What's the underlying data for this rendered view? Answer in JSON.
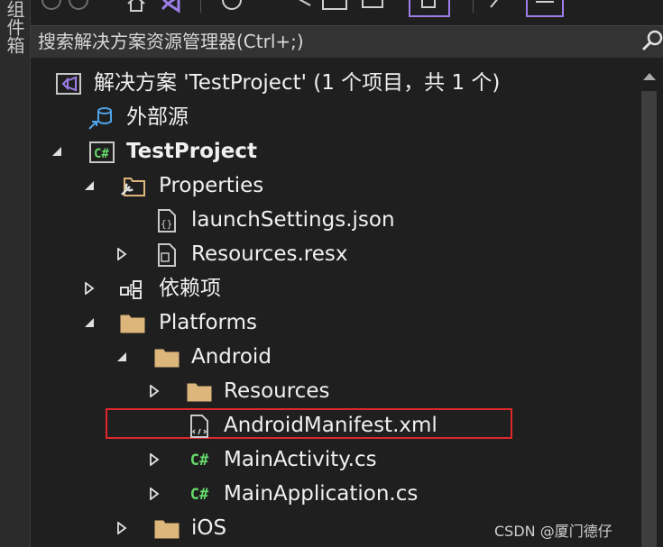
{
  "left_panel": {
    "label": "组件箱"
  },
  "search": {
    "placeholder": "搜索解决方案资源管理器(Ctrl+;)"
  },
  "tree": {
    "solution": "解决方案 'TestProject' (1 个项目，共 1 个)",
    "external_sources": "外部源",
    "project": "TestProject",
    "properties": "Properties",
    "launch_settings": "launchSettings.json",
    "resources_resx": "Resources.resx",
    "dependencies": "依赖项",
    "platforms": "Platforms",
    "android": "Android",
    "resources": "Resources",
    "android_manifest": "AndroidManifest.xml",
    "main_activity": "MainActivity.cs",
    "main_application": "MainApplication.cs",
    "ios": "iOS"
  },
  "icons": {
    "csharp_glyph": "C#"
  },
  "colors": {
    "accent_purple": "#9d7ee8",
    "highlight_red": "#e0282b",
    "folder": "#dcb67a",
    "csharp_green": "#66d96b"
  },
  "watermark": "CSDN @厦门德仔"
}
